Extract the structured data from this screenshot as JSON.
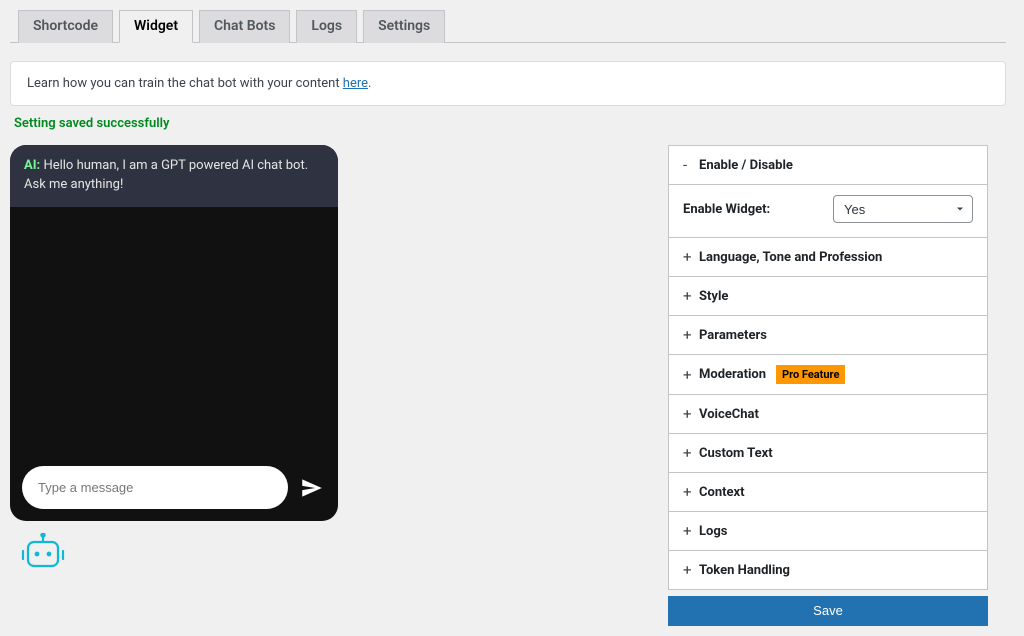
{
  "tabs": {
    "shortcode": "Shortcode",
    "widget": "Widget",
    "chatbots": "Chat Bots",
    "logs": "Logs",
    "settings": "Settings"
  },
  "notice": {
    "text": "Learn how you can train the chat bot with your content ",
    "link_text": "here"
  },
  "success_message": "Setting saved successfully",
  "chat": {
    "ai_label": "AI:",
    "greeting": "Hello human, I am a GPT powered AI chat bot. Ask me anything!",
    "placeholder": "Type a message"
  },
  "panel": {
    "enable_section_title": "Enable / Disable",
    "enable_widget_label": "Enable Widget:",
    "enable_widget_value": "Yes",
    "sections": {
      "lang": "Language, Tone and Profession",
      "style": "Style",
      "params": "Parameters",
      "moderation": "Moderation",
      "pro_badge": "Pro Feature",
      "voice": "VoiceChat",
      "custom_text": "Custom Text",
      "context": "Context",
      "logs": "Logs",
      "token": "Token Handling"
    },
    "save": "Save"
  }
}
